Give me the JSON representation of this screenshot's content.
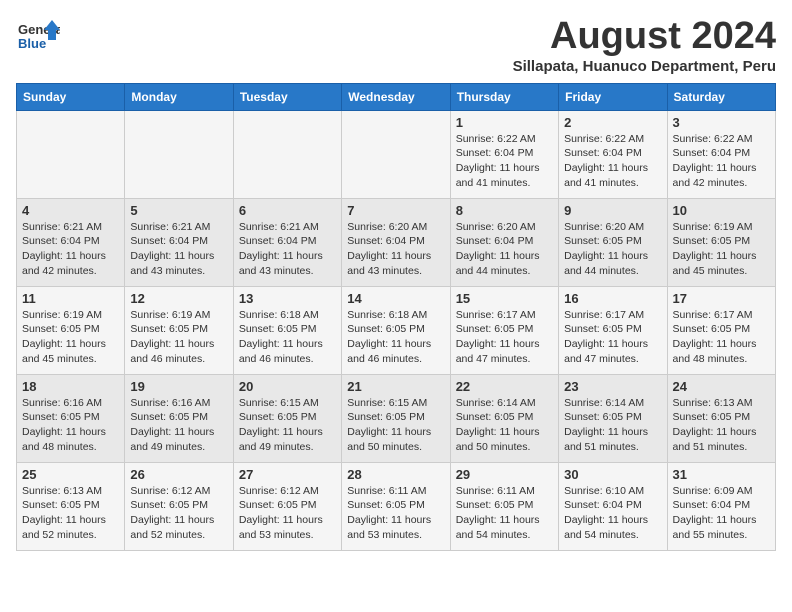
{
  "header": {
    "logo_general": "General",
    "logo_blue": "Blue",
    "month_title": "August 2024",
    "location": "Sillapata, Huanuco Department, Peru"
  },
  "calendar": {
    "days_of_week": [
      "Sunday",
      "Monday",
      "Tuesday",
      "Wednesday",
      "Thursday",
      "Friday",
      "Saturday"
    ],
    "weeks": [
      [
        {
          "day": "",
          "info": ""
        },
        {
          "day": "",
          "info": ""
        },
        {
          "day": "",
          "info": ""
        },
        {
          "day": "",
          "info": ""
        },
        {
          "day": "1",
          "sunrise": "6:22 AM",
          "sunset": "6:04 PM",
          "daylight": "11 hours and 41 minutes."
        },
        {
          "day": "2",
          "sunrise": "6:22 AM",
          "sunset": "6:04 PM",
          "daylight": "11 hours and 41 minutes."
        },
        {
          "day": "3",
          "sunrise": "6:22 AM",
          "sunset": "6:04 PM",
          "daylight": "11 hours and 42 minutes."
        }
      ],
      [
        {
          "day": "4",
          "sunrise": "6:21 AM",
          "sunset": "6:04 PM",
          "daylight": "11 hours and 42 minutes."
        },
        {
          "day": "5",
          "sunrise": "6:21 AM",
          "sunset": "6:04 PM",
          "daylight": "11 hours and 43 minutes."
        },
        {
          "day": "6",
          "sunrise": "6:21 AM",
          "sunset": "6:04 PM",
          "daylight": "11 hours and 43 minutes."
        },
        {
          "day": "7",
          "sunrise": "6:20 AM",
          "sunset": "6:04 PM",
          "daylight": "11 hours and 43 minutes."
        },
        {
          "day": "8",
          "sunrise": "6:20 AM",
          "sunset": "6:04 PM",
          "daylight": "11 hours and 44 minutes."
        },
        {
          "day": "9",
          "sunrise": "6:20 AM",
          "sunset": "6:05 PM",
          "daylight": "11 hours and 44 minutes."
        },
        {
          "day": "10",
          "sunrise": "6:19 AM",
          "sunset": "6:05 PM",
          "daylight": "11 hours and 45 minutes."
        }
      ],
      [
        {
          "day": "11",
          "sunrise": "6:19 AM",
          "sunset": "6:05 PM",
          "daylight": "11 hours and 45 minutes."
        },
        {
          "day": "12",
          "sunrise": "6:19 AM",
          "sunset": "6:05 PM",
          "daylight": "11 hours and 46 minutes."
        },
        {
          "day": "13",
          "sunrise": "6:18 AM",
          "sunset": "6:05 PM",
          "daylight": "11 hours and 46 minutes."
        },
        {
          "day": "14",
          "sunrise": "6:18 AM",
          "sunset": "6:05 PM",
          "daylight": "11 hours and 46 minutes."
        },
        {
          "day": "15",
          "sunrise": "6:17 AM",
          "sunset": "6:05 PM",
          "daylight": "11 hours and 47 minutes."
        },
        {
          "day": "16",
          "sunrise": "6:17 AM",
          "sunset": "6:05 PM",
          "daylight": "11 hours and 47 minutes."
        },
        {
          "day": "17",
          "sunrise": "6:17 AM",
          "sunset": "6:05 PM",
          "daylight": "11 hours and 48 minutes."
        }
      ],
      [
        {
          "day": "18",
          "sunrise": "6:16 AM",
          "sunset": "6:05 PM",
          "daylight": "11 hours and 48 minutes."
        },
        {
          "day": "19",
          "sunrise": "6:16 AM",
          "sunset": "6:05 PM",
          "daylight": "11 hours and 49 minutes."
        },
        {
          "day": "20",
          "sunrise": "6:15 AM",
          "sunset": "6:05 PM",
          "daylight": "11 hours and 49 minutes."
        },
        {
          "day": "21",
          "sunrise": "6:15 AM",
          "sunset": "6:05 PM",
          "daylight": "11 hours and 50 minutes."
        },
        {
          "day": "22",
          "sunrise": "6:14 AM",
          "sunset": "6:05 PM",
          "daylight": "11 hours and 50 minutes."
        },
        {
          "day": "23",
          "sunrise": "6:14 AM",
          "sunset": "6:05 PM",
          "daylight": "11 hours and 51 minutes."
        },
        {
          "day": "24",
          "sunrise": "6:13 AM",
          "sunset": "6:05 PM",
          "daylight": "11 hours and 51 minutes."
        }
      ],
      [
        {
          "day": "25",
          "sunrise": "6:13 AM",
          "sunset": "6:05 PM",
          "daylight": "11 hours and 52 minutes."
        },
        {
          "day": "26",
          "sunrise": "6:12 AM",
          "sunset": "6:05 PM",
          "daylight": "11 hours and 52 minutes."
        },
        {
          "day": "27",
          "sunrise": "6:12 AM",
          "sunset": "6:05 PM",
          "daylight": "11 hours and 53 minutes."
        },
        {
          "day": "28",
          "sunrise": "6:11 AM",
          "sunset": "6:05 PM",
          "daylight": "11 hours and 53 minutes."
        },
        {
          "day": "29",
          "sunrise": "6:11 AM",
          "sunset": "6:05 PM",
          "daylight": "11 hours and 54 minutes."
        },
        {
          "day": "30",
          "sunrise": "6:10 AM",
          "sunset": "6:04 PM",
          "daylight": "11 hours and 54 minutes."
        },
        {
          "day": "31",
          "sunrise": "6:09 AM",
          "sunset": "6:04 PM",
          "daylight": "11 hours and 55 minutes."
        }
      ]
    ]
  }
}
